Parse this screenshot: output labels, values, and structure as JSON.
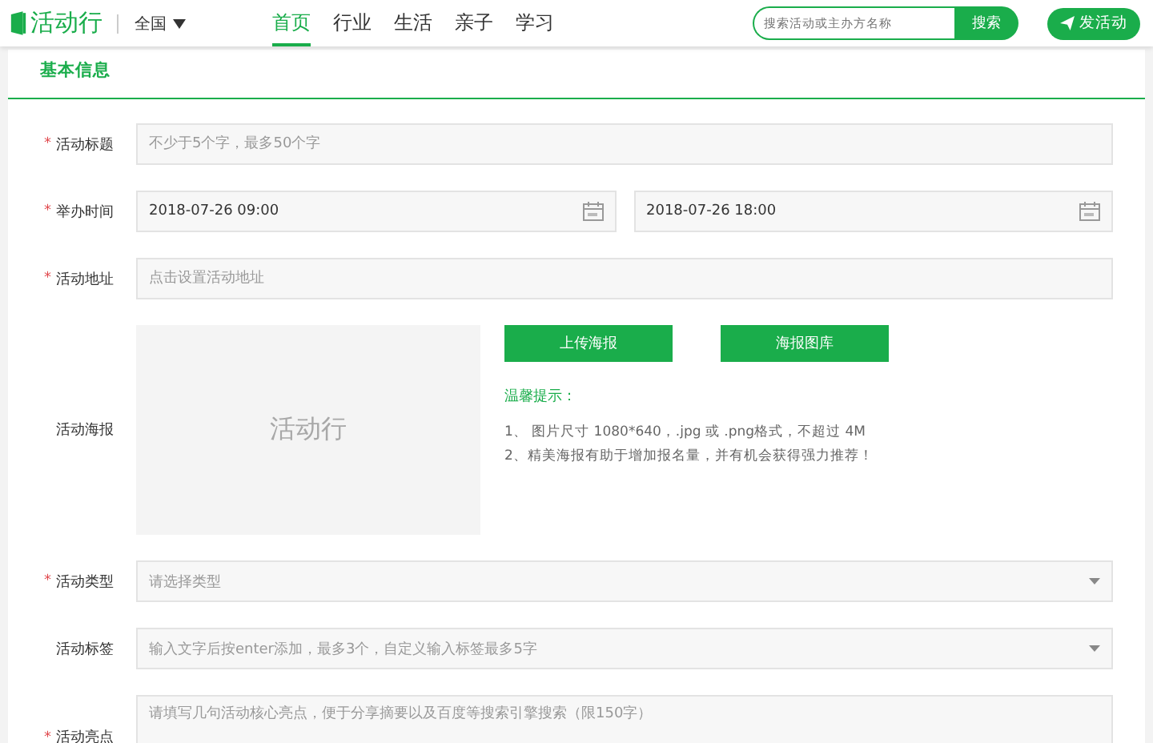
{
  "header": {
    "logo": "活动行",
    "region": "全国",
    "nav": [
      {
        "label": "首页",
        "selected": true
      },
      {
        "label": "行业",
        "selected": false
      },
      {
        "label": "生活",
        "selected": false
      },
      {
        "label": "亲子",
        "selected": false
      },
      {
        "label": "学习",
        "selected": false
      }
    ],
    "search": {
      "placeholder": "搜索活动或主办方名称",
      "button": "搜索"
    },
    "publish_button": "发活动"
  },
  "section_title": "基本信息",
  "required_mark": "*",
  "fields": [
    {
      "kind": "text",
      "label": "活动标题",
      "required": true,
      "placeholder": "不少于5个字，最多50个字"
    },
    {
      "kind": "daterange",
      "label": "举办时间",
      "required": true,
      "start": "2018-07-26 09:00",
      "end": "2018-07-26 18:00"
    },
    {
      "kind": "text",
      "label": "活动地址",
      "required": true,
      "placeholder": "点击设置活动地址"
    },
    {
      "kind": "poster",
      "label": "活动海报",
      "required": false,
      "placeholder_logo": "活动行",
      "buttons": [
        "上传海报",
        "海报图库"
      ],
      "tips_title": "温馨提示：",
      "tips": [
        "1、 图片尺寸 1080*640，.jpg 或 .png格式，不超过 4M",
        "2、精美海报有助于增加报名量，并有机会获得强力推荐！"
      ]
    },
    {
      "kind": "select",
      "label": "活动类型",
      "required": true,
      "placeholder": "请选择类型"
    },
    {
      "kind": "select",
      "label": "活动标签",
      "required": false,
      "placeholder": "输入文字后按enter添加，最多3个，自定义输入标签最多5字"
    },
    {
      "kind": "textarea",
      "label": "活动亮点",
      "required": true,
      "placeholder": "请填写几句活动核心亮点，便于分享摘要以及百度等搜索引擎搜索（限150字）"
    }
  ]
}
